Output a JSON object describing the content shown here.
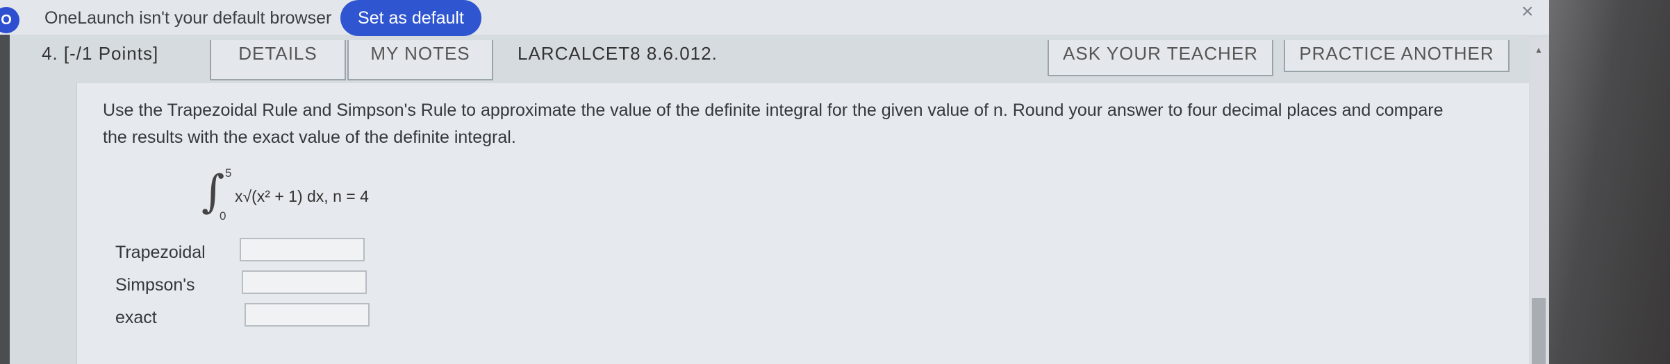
{
  "notification": {
    "icon_text": "O",
    "message": "OneLaunch isn't your default browser",
    "button_label": "Set as default",
    "close_label": "×"
  },
  "toolbar": {
    "question_label": "4. [-/1 Points]",
    "details": "DETAILS",
    "my_notes": "MY NOTES",
    "course_code": "LARCALCET8 8.6.012.",
    "ask_teacher": "ASK YOUR TEACHER",
    "practice_another": "PRACTICE ANOTHER"
  },
  "question": {
    "instructions": "Use the Trapezoidal Rule and Simpson's Rule to approximate the value of the definite integral for the given value of n. Round your answer to four decimal places and compare the results with the exact value of the definite integral.",
    "integral": {
      "lower": "0",
      "upper": "5",
      "integrand": "x√(x² + 1) dx,  n = 4"
    },
    "answers": [
      {
        "label": "Trapezoidal",
        "value": ""
      },
      {
        "label": "Simpson's",
        "value": ""
      },
      {
        "label": "exact",
        "value": ""
      }
    ]
  },
  "colors": {
    "accent": "#2f55d0",
    "panel": "#e6eaee"
  }
}
